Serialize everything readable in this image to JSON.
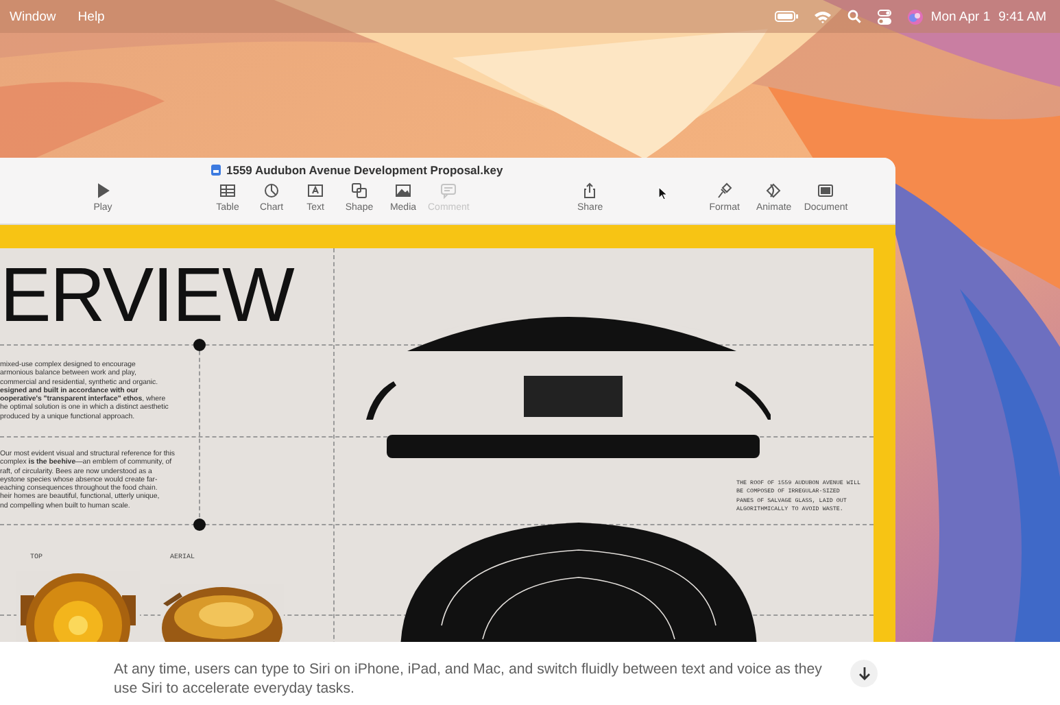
{
  "menu_bar": {
    "menus": [
      "Window",
      "Help"
    ],
    "date": "Mon Apr 1",
    "time": "9:41 AM"
  },
  "window": {
    "title": "1559 Audubon Avenue Development Proposal.key",
    "toolbar_groups": [
      {
        "items": [
          {
            "label": "Play",
            "kind": "play",
            "disabled": false
          }
        ]
      },
      {
        "items": [
          {
            "label": "Table",
            "kind": "table",
            "disabled": false
          },
          {
            "label": "Chart",
            "kind": "chart",
            "disabled": false
          },
          {
            "label": "Text",
            "kind": "text",
            "disabled": false
          },
          {
            "label": "Shape",
            "kind": "shape",
            "disabled": false
          },
          {
            "label": "Media",
            "kind": "media",
            "disabled": false
          },
          {
            "label": "Comment",
            "kind": "comment",
            "disabled": true
          }
        ]
      },
      {
        "items": [
          {
            "label": "Share",
            "kind": "share",
            "disabled": false
          }
        ]
      },
      {
        "items": [
          {
            "label": "Format",
            "kind": "format",
            "disabled": false
          },
          {
            "label": "Animate",
            "kind": "animate",
            "disabled": false
          },
          {
            "label": "Document",
            "kind": "document",
            "disabled": false
          }
        ]
      }
    ]
  },
  "slide": {
    "heading": "ERVIEW",
    "paragraphs": [
      "mixed-use complex designed to encourage\narmonious balance between work and play,\ncommercial and residential, synthetic and organic.\n**esigned and built in accordance with our\nooperative's \"transparent interface\" ethos**, where\nhe optimal solution is one in which a distinct aesthetic\nproduced by a unique functional approach.",
      "Our most evident visual and structural reference for this\ncomplex **is the beehive**—an emblem of community, of\nraft, of circularity. Bees are now understood as a\neystone species whose absence would create far-\neaching consequences throughout the food chain.\nheir homes are beautiful, functional, utterly unique,\nnd compelling when built to human scale."
    ],
    "photo_labels": [
      "TOP",
      "AERIAL"
    ],
    "note": "THE ROOF OF 1559 AUDUBON AVENUE WILL\nBE COMPOSED OF IRREGULAR-SIZED\nPANES OF SALVAGE GLASS, LAID OUT\nALGORITHMICALLY TO AVOID WASTE."
  },
  "caption": {
    "text": "At any time, users can type to Siri on iPhone, iPad, and Mac, and switch fluidly between text and voice as they use Siri to accelerate everyday tasks."
  }
}
